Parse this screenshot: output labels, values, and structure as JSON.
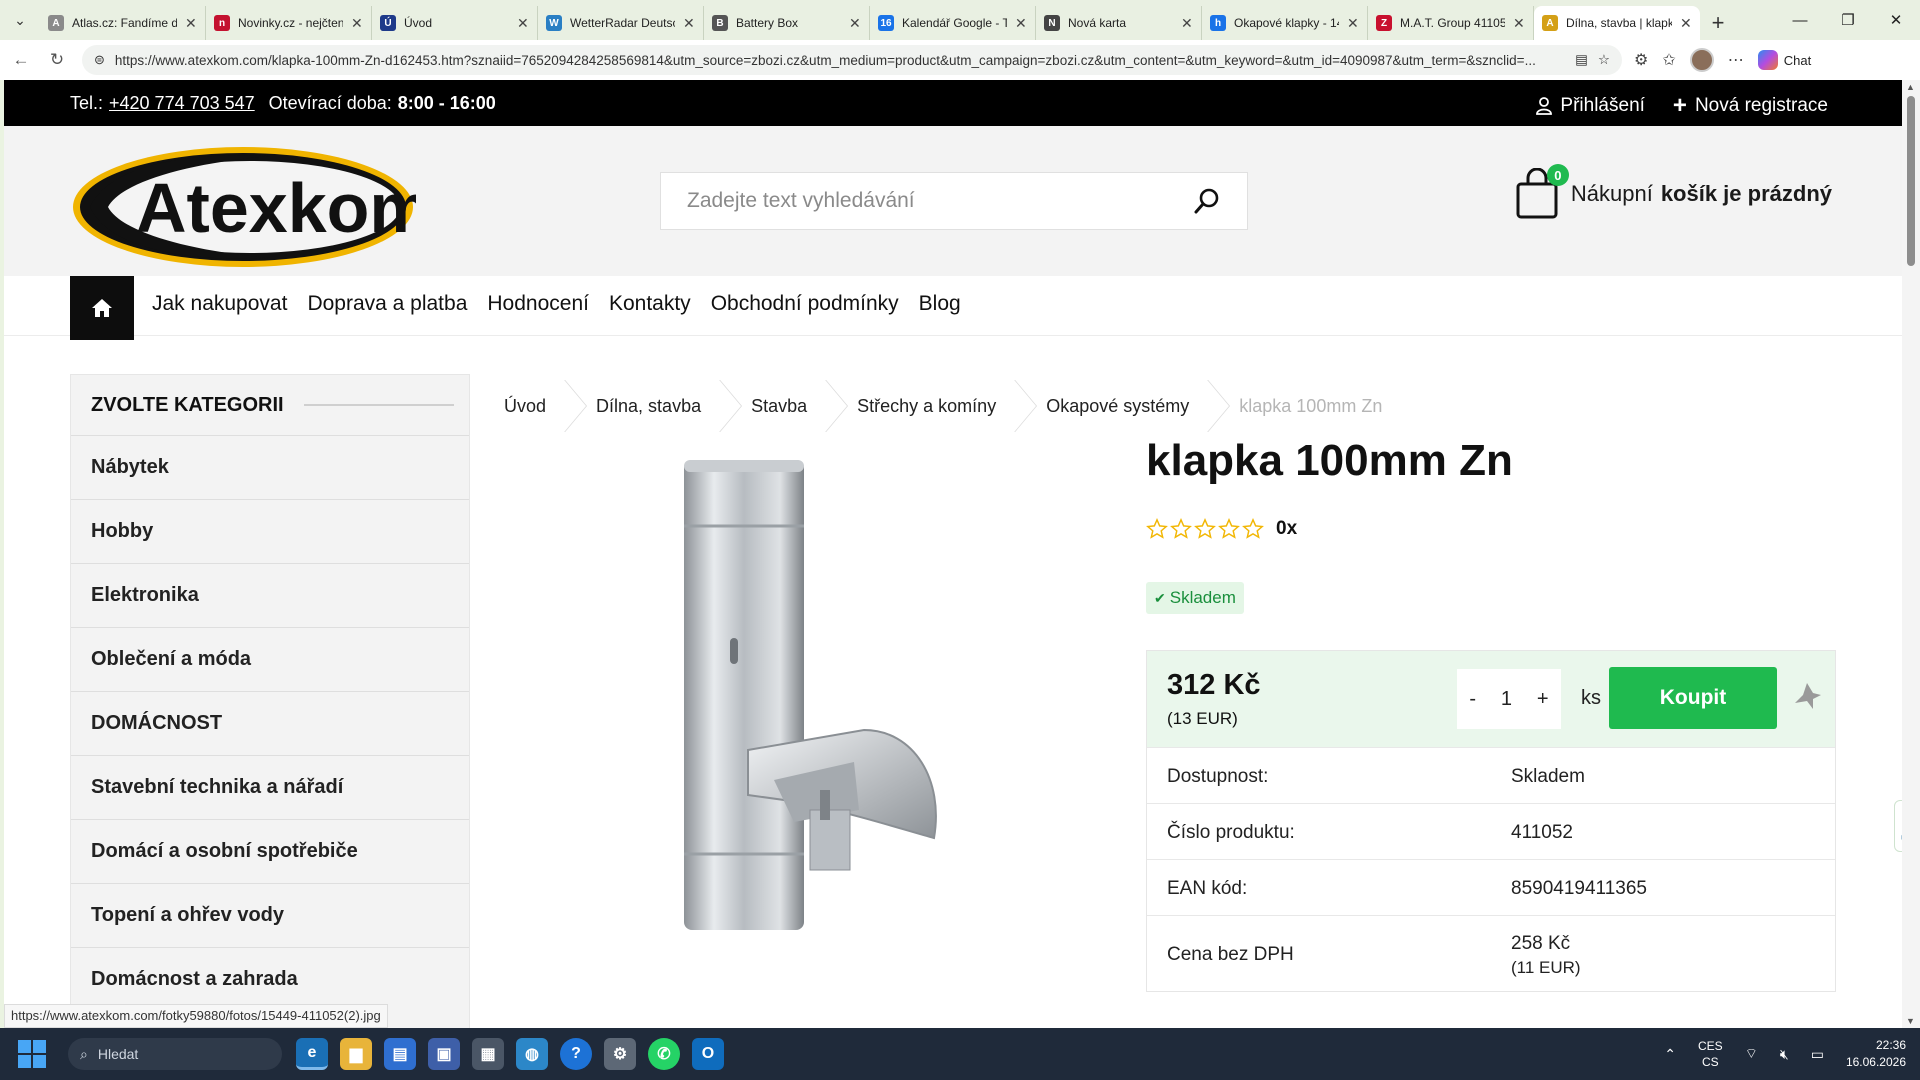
{
  "browser": {
    "tabs": [
      {
        "label": "Atlas.cz: Fandíme do",
        "fav_color": "#8a8a8a",
        "fav_glyph": "A"
      },
      {
        "label": "Novinky.cz - nejčten",
        "fav_color": "#c4122f",
        "fav_glyph": "n"
      },
      {
        "label": "Úvod",
        "fav_color": "#1e3a8a",
        "fav_glyph": "Ú"
      },
      {
        "label": "WetterRadar Deutsch",
        "fav_color": "#2a7fc4",
        "fav_glyph": "W"
      },
      {
        "label": "Battery Box",
        "fav_color": "#555555",
        "fav_glyph": "B"
      },
      {
        "label": "Kalendář Google - T",
        "fav_color": "#1a73e8",
        "fav_glyph": "16"
      },
      {
        "label": "Nová karta",
        "fav_color": "#444444",
        "fav_glyph": "N"
      },
      {
        "label": "Okapové klapky - 14",
        "fav_color": "#1a73e8",
        "fav_glyph": "h"
      },
      {
        "label": "M.A.T. Group 41105",
        "fav_color": "#c8102e",
        "fav_glyph": "Z"
      },
      {
        "label": "Dílna, stavba | klapk",
        "fav_color": "#d4a017",
        "fav_glyph": "A"
      }
    ],
    "active_tab": 9,
    "url": "https://www.atexkom.com/klapka-100mm-Zn-d162453.htm?sznaiid=7652094284258569814&utm_source=zbozi.cz&utm_medium=product&utm_campaign=zbozi.cz&utm_content=&utm_keyword=&utm_id=4090987&utm_term=&sznclid=...",
    "chat_label": "Chat"
  },
  "topbar": {
    "phone_label": "Tel.:",
    "phone": "+420 774 703 547",
    "hours_label": "Otevírací doba:",
    "hours": "8:00 - 16:00",
    "login": "Přihlášení",
    "register": "Nová registrace"
  },
  "header": {
    "logo_text": "Atexkom",
    "search_placeholder": "Zadejte text vyhledávání",
    "cart_count": "0",
    "cart_label": "Nákupní",
    "cart_status": "košík je prázdný"
  },
  "nav": {
    "items": [
      "Jak nakupovat",
      "Doprava a platba",
      "Hodnocení",
      "Kontakty",
      "Obchodní podmínky",
      "Blog"
    ]
  },
  "sidebar": {
    "title": "ZVOLTE KATEGORII",
    "items": [
      "Nábytek",
      "Hobby",
      "Elektronika",
      "Oblečení a móda",
      "DOMÁCNOST",
      "Stavební technika a nářadí",
      "Domácí a osobní spotřebiče",
      "Topení a ohřev vody",
      "Domácnost a zahrada"
    ]
  },
  "breadcrumbs": [
    "Úvod",
    "Dílna, stavba",
    "Stavba",
    "Střechy a komíny",
    "Okapové systémy",
    "klapka 100mm Zn"
  ],
  "product": {
    "title": "klapka 100mm Zn",
    "rating_count": "0x",
    "stars": 0,
    "stock_badge": "Skladem",
    "price": "312 Kč",
    "price_eur": "(13 EUR)",
    "qty": "1",
    "qty_minus": "-",
    "qty_plus": "+",
    "unit": "ks",
    "buy_label": "Koupit",
    "details": [
      {
        "key": "Dostupnost:",
        "value": "Skladem"
      },
      {
        "key": "Číslo produktu:",
        "value": "411052"
      },
      {
        "key": "EAN kód:",
        "value": "8590419411365"
      },
      {
        "key": "Cena bez DPH",
        "value": "258 Kč",
        "sub": "(11 EUR)"
      }
    ]
  },
  "status_url": "https://www.atexkom.com/fotky59880/fotos/15449-411052(2).jpg",
  "taskbar": {
    "search_label": "Hledat",
    "lang_top": "CES",
    "lang_bottom": "CS",
    "time": "22:36",
    "date": "16.06.2026"
  },
  "colors": {
    "accent_green": "#1fba4f",
    "star_yellow": "#f2b705",
    "topbar_black": "#000000"
  }
}
